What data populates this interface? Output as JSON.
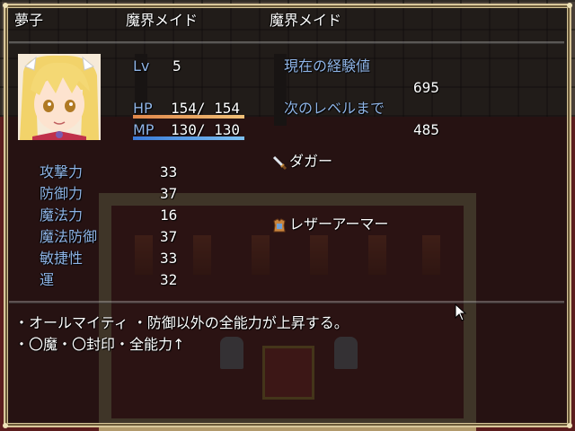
{
  "header": {
    "name": "夢子",
    "class": "魔界メイド",
    "nickname": "魔界メイド"
  },
  "status": {
    "lv_label": "Lv",
    "lv_value": "5",
    "hp_label": "HP",
    "hp_value": "154/ 154",
    "hp_ratio": 1.0,
    "mp_label": "MP",
    "mp_value": "130/ 130",
    "mp_ratio": 1.0
  },
  "exp": {
    "current_label": "現在の経験値",
    "current_value": "695",
    "next_label": "次のレベルまで",
    "next_value": "485"
  },
  "params": [
    {
      "label": "攻撃力",
      "value": "33"
    },
    {
      "label": "防御力",
      "value": "37"
    },
    {
      "label": "魔法力",
      "value": "16"
    },
    {
      "label": "魔法防御",
      "value": "37"
    },
    {
      "label": "敏捷性",
      "value": "33"
    },
    {
      "label": "運",
      "value": "32"
    }
  ],
  "equipment": [
    {
      "name": "ダガー",
      "icon": "dagger-icon"
    },
    {
      "name": "",
      "icon": ""
    },
    {
      "name": "",
      "icon": ""
    },
    {
      "name": "レザーアーマー",
      "icon": "armor-icon"
    }
  ],
  "profile": {
    "line1": "・オールマイティ ・防御以外の全能力が上昇する。",
    "line2": "・〇魔・〇封印・全能力↑"
  },
  "colors": {
    "system_text": "#8fb4e6",
    "hp_gauge_start": "#e0874a",
    "hp_gauge_end": "#f0c078",
    "mp_gauge_start": "#3a7ad8",
    "mp_gauge_end": "#7cc0f0",
    "window_border": "#d8c79a"
  }
}
